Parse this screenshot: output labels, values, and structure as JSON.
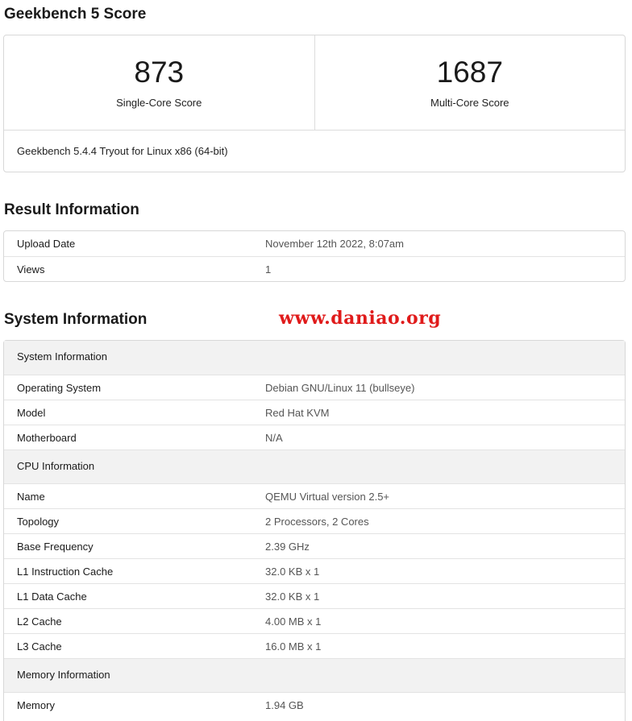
{
  "score_section": {
    "title": "Geekbench 5 Score",
    "single_core": {
      "value": "873",
      "label": "Single-Core Score"
    },
    "multi_core": {
      "value": "1687",
      "label": "Multi-Core Score"
    },
    "version": "Geekbench 5.4.4 Tryout for Linux x86 (64-bit)"
  },
  "result_section": {
    "title": "Result Information",
    "rows": [
      {
        "key": "Upload Date",
        "value": "November 12th 2022, 8:07am"
      },
      {
        "key": "Views",
        "value": "1"
      }
    ]
  },
  "system_section": {
    "title": "System Information",
    "watermark": "www.daniao.org",
    "groups": [
      {
        "header": "System Information",
        "rows": [
          {
            "key": "Operating System",
            "value": "Debian GNU/Linux 11 (bullseye)"
          },
          {
            "key": "Model",
            "value": "Red Hat KVM"
          },
          {
            "key": "Motherboard",
            "value": "N/A"
          }
        ]
      },
      {
        "header": "CPU Information",
        "rows": [
          {
            "key": "Name",
            "value": "QEMU Virtual version 2.5+"
          },
          {
            "key": "Topology",
            "value": "2 Processors, 2 Cores"
          },
          {
            "key": "Base Frequency",
            "value": "2.39 GHz"
          },
          {
            "key": "L1 Instruction Cache",
            "value": "32.0 KB x 1"
          },
          {
            "key": "L1 Data Cache",
            "value": "32.0 KB x 1"
          },
          {
            "key": "L2 Cache",
            "value": "4.00 MB x 1"
          },
          {
            "key": "L3 Cache",
            "value": "16.0 MB x 1"
          }
        ]
      },
      {
        "header": "Memory Information",
        "rows": [
          {
            "key": "Memory",
            "value": "1.94 GB"
          }
        ]
      }
    ]
  }
}
